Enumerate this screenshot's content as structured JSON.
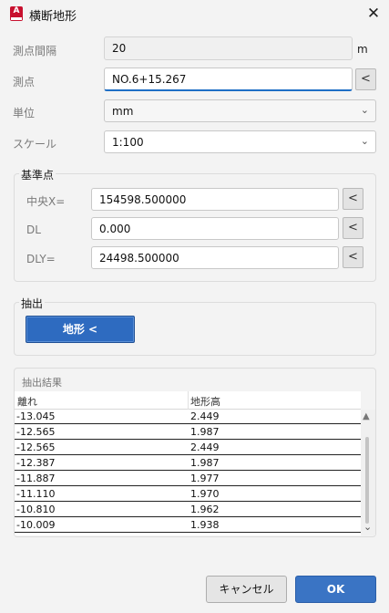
{
  "window": {
    "title": "横断地形",
    "app_icon_letter": "A"
  },
  "form": {
    "interval_label": "測点間隔",
    "interval_value": "20",
    "interval_unit": "m",
    "station_label": "測点",
    "station_value": "NO.6+15.267",
    "unit_label": "単位",
    "unit_value": "mm",
    "scale_label": "スケール",
    "scale_value": "1:100"
  },
  "reference": {
    "group_label": "基準点",
    "cx_label": "中央X=",
    "cx_value": "154598.500000",
    "dl_label": "DL",
    "dl_value": "0.000",
    "dly_label": "DLY=",
    "dly_value": "24498.500000"
  },
  "extract": {
    "group_label": "抽出",
    "button_label": "地形 <"
  },
  "results": {
    "group_label": "抽出結果",
    "columns": [
      "離れ",
      "地形高"
    ],
    "rows": [
      [
        "-13.045",
        "2.449"
      ],
      [
        "-12.565",
        "1.987"
      ],
      [
        "-12.565",
        "2.449"
      ],
      [
        "-12.387",
        "1.987"
      ],
      [
        "-11.887",
        "1.977"
      ],
      [
        "-11.110",
        "1.970"
      ],
      [
        "-10.810",
        "1.962"
      ],
      [
        "-10.009",
        "1.938"
      ]
    ]
  },
  "pick_label": "<",
  "footer": {
    "cancel_label": "キャンセル",
    "ok_label": "OK"
  },
  "colors": {
    "accent": "#2e6bc0",
    "app_icon": "#c8102e"
  }
}
